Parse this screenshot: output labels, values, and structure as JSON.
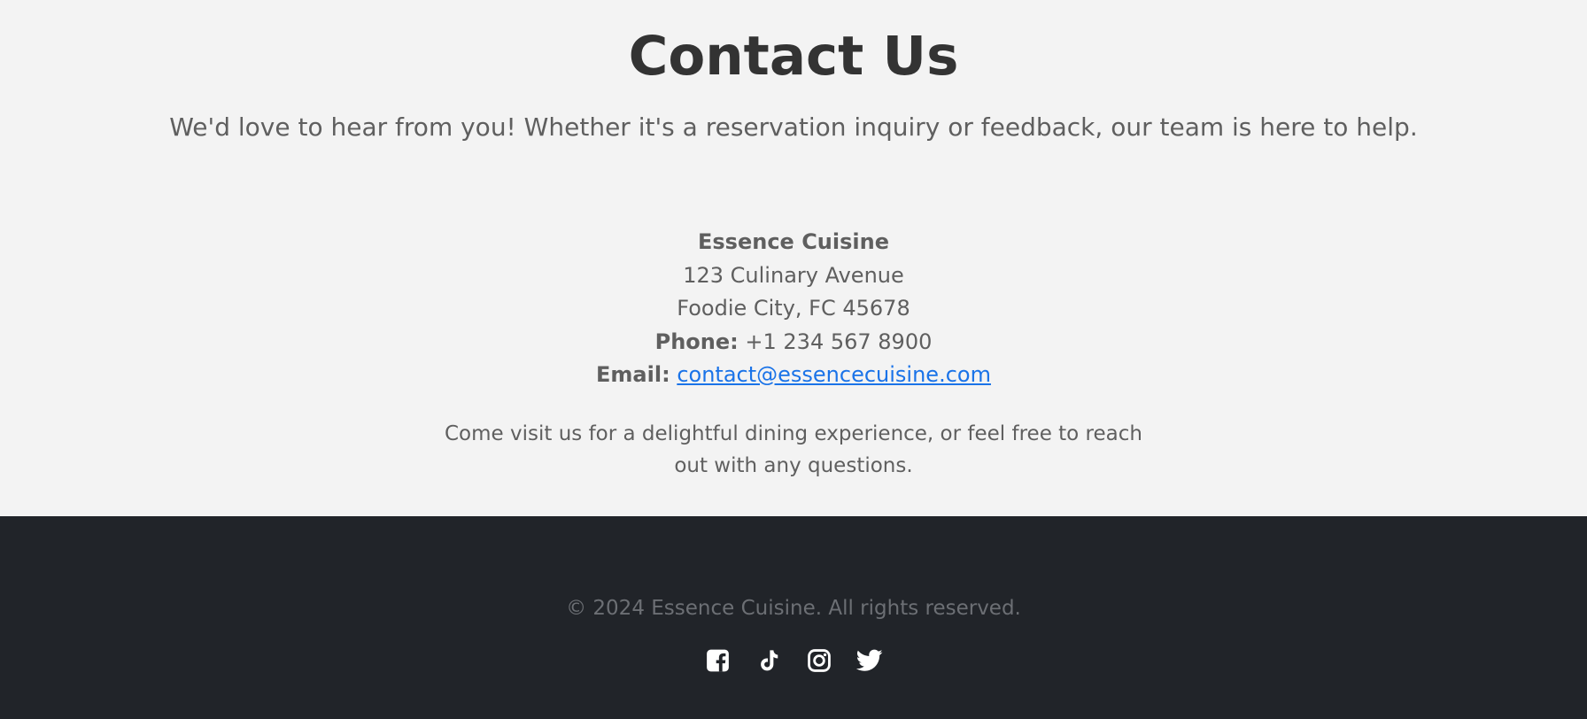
{
  "contact": {
    "title": "Contact Us",
    "subtitle": "We'd love to hear from you! Whether it's a reservation inquiry or feedback, our team is here to help.",
    "business_name": "Essence Cuisine",
    "address_line1": "123 Culinary Avenue",
    "address_line2": "Foodie City, FC 45678",
    "phone_label": "Phone:",
    "phone_value": "+1 234 567 8900",
    "email_label": "Email:",
    "email_value": "contact@essencecuisine.com",
    "closing_text": "Come visit us for a delightful dining experience, or feel free to reach out with any questions."
  },
  "footer": {
    "copyright": "© 2024 Essence Cuisine. All rights reserved.",
    "social_icons": [
      "facebook-icon",
      "tiktok-icon",
      "instagram-icon",
      "twitter-icon"
    ]
  },
  "colors": {
    "page_background": "#f3f3f3",
    "heading_text": "#333333",
    "body_text": "#5f5f5f",
    "link": "#1a73e8",
    "footer_background": "#212429",
    "footer_text": "#6c6f74",
    "icon": "#ffffff"
  }
}
